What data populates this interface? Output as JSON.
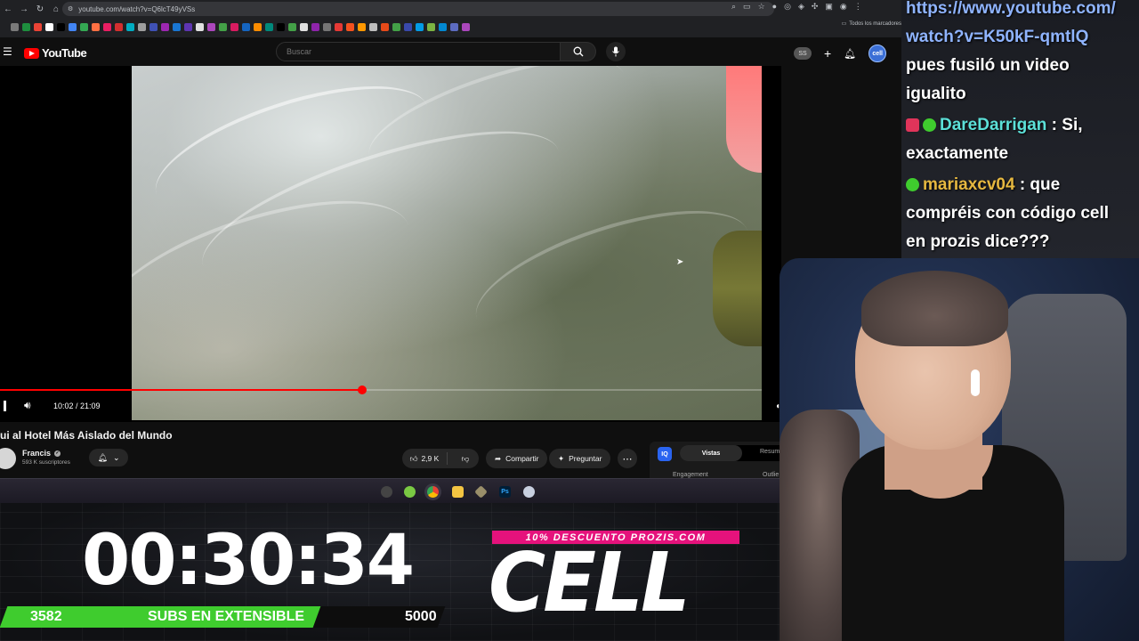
{
  "browser": {
    "url": "youtube.com/watch?v=Q6lcT49yVSs",
    "bookmarks_folder": "Todos los marcadores",
    "bookmark_colors": [
      "#7a7a7a",
      "#1e8e3e",
      "#ea4335",
      "#ffffff",
      "#000000",
      "#4285f4",
      "#34a853",
      "#ff7043",
      "#e91e63",
      "#d32f2f",
      "#00acc1",
      "#9e9e9e",
      "#3f51b5",
      "#9c27b0",
      "#1976d2",
      "#5e35b1",
      "#e0e0e0",
      "#ab47bc",
      "#43a047",
      "#d81b60",
      "#1565c0",
      "#fb8c00",
      "#00897b",
      "#000000",
      "#43a047",
      "#e0e0e0",
      "#8e24aa",
      "#757575",
      "#e53935",
      "#f4511e",
      "#ff9800",
      "#bdbdbd",
      "#e64a19",
      "#43a047",
      "#3949ab",
      "#039be5",
      "#7cb342",
      "#0288d1",
      "#5c6bc0",
      "#ab47bc"
    ]
  },
  "youtube": {
    "logo_text": "YouTube",
    "search_placeholder": "Buscar",
    "account_badge": "SS",
    "avatar_text": "cell",
    "player": {
      "time": "10:02 / 21:09",
      "progress": 0.475
    },
    "video_title": "ui al Hotel Más Aislado del Mundo",
    "channel": {
      "name": "Francis",
      "subscribers": "593 K suscriptores"
    },
    "actions": {
      "likes": "2,9 K",
      "share": "Compartir",
      "ask": "Preguntar"
    },
    "panel": {
      "icon_text": "IQ",
      "tab_views": "Vistas",
      "tab_summary": "Resum",
      "engagement": "Engagement",
      "outlier": "Outlie"
    }
  },
  "overlay": {
    "timer": "00:30:34",
    "subs_current": "3582",
    "subs_label": "SUBS EN EXTENSIBLE",
    "subs_goal": "5000",
    "subs_fraction": 0.7164,
    "promo": "10% DESCUENTO PROZIS.COM",
    "brand": "CELL"
  },
  "chat": {
    "line1": "https://www.youtube.com/",
    "line2": "watch?v=K50kF-qmtlQ",
    "line3": "pues fusiló un video",
    "line4": "igualito",
    "user1": "DareDarrigan",
    "msg1a": " : Si,",
    "msg1b": "exactamente",
    "user2": "mariaxcv04",
    "msg2a": " : que",
    "msg2b": "compréis con código cell",
    "msg2c": "en prozis dice???"
  },
  "colors": {
    "yt_red": "#ff0000",
    "subs_green": "#3fcc2e",
    "promo_pink": "#e5127c"
  }
}
